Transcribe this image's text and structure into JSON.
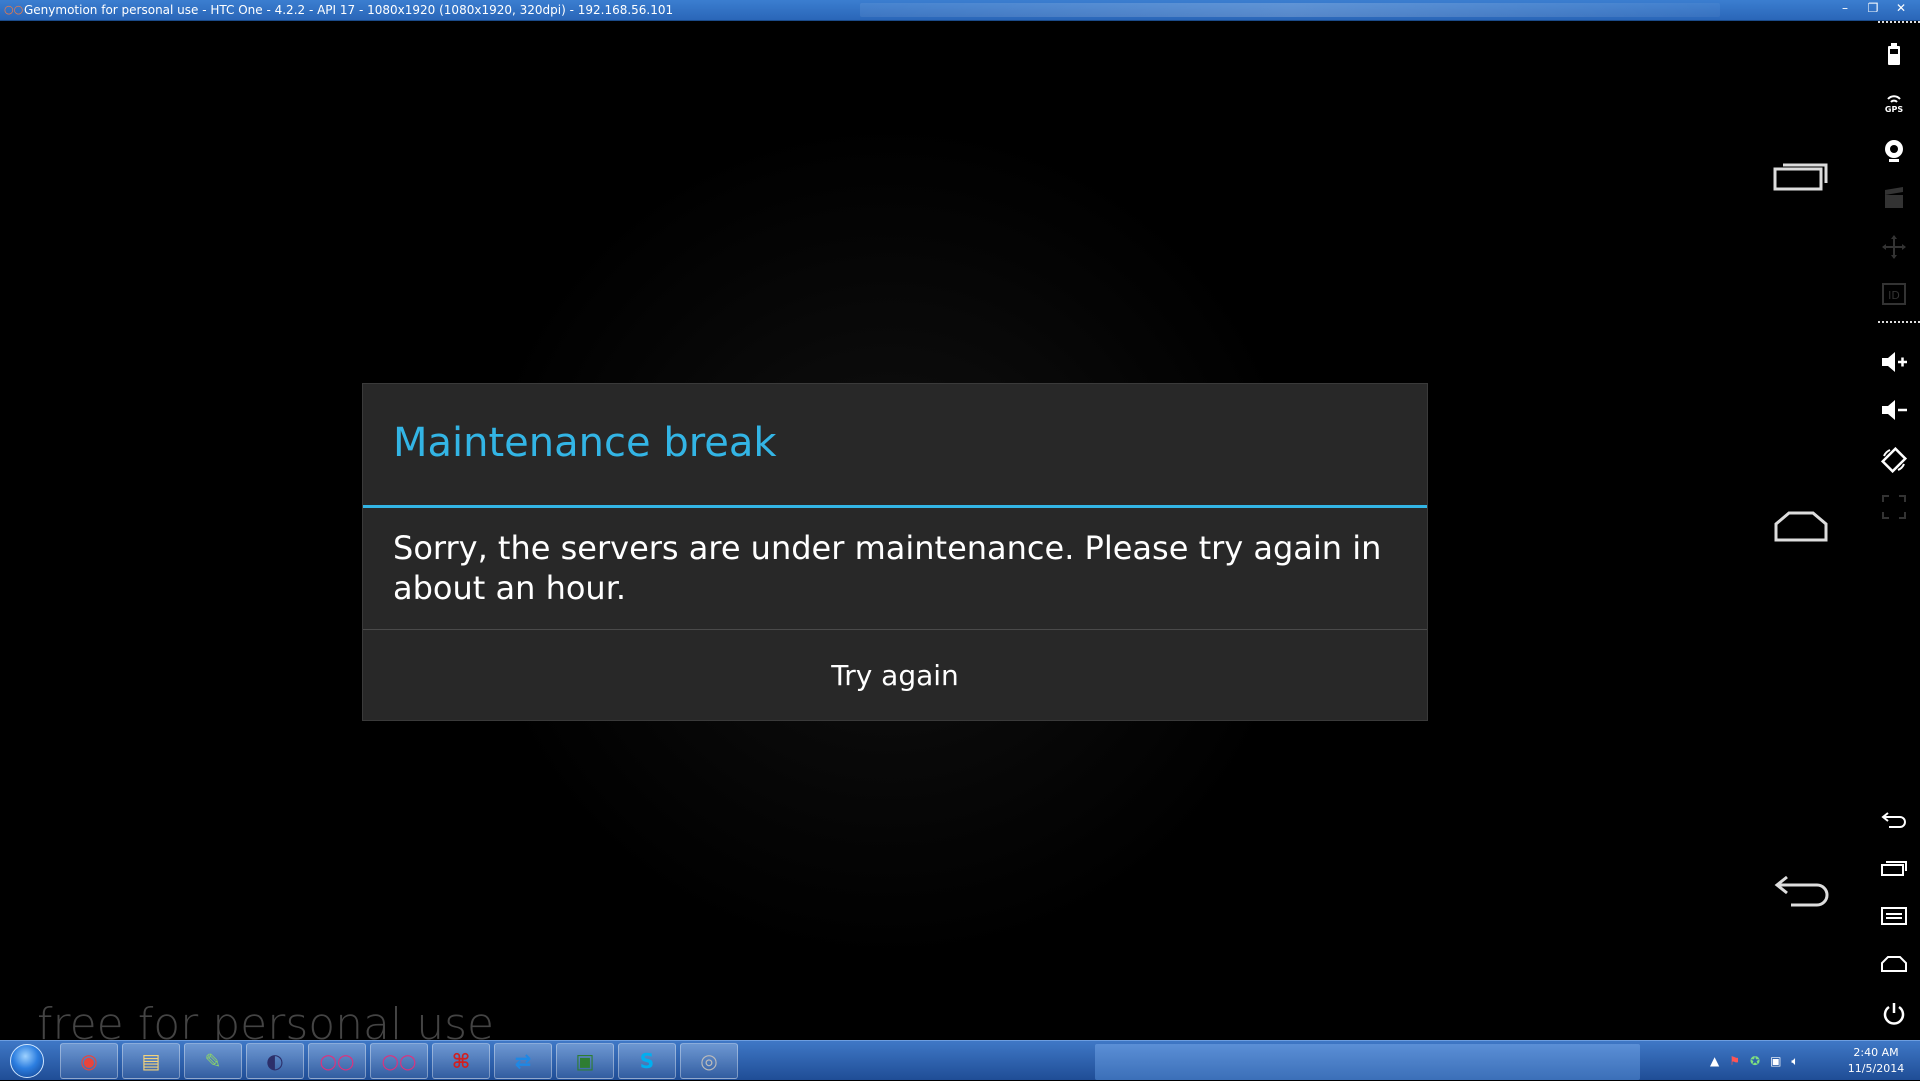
{
  "window": {
    "title": "Genymotion for personal use - HTC One - 4.2.2 - API 17 - 1080x1920 (1080x1920, 320dpi) - 192.168.56.101",
    "minimize": "–",
    "restore": "❐",
    "close": "✕"
  },
  "dialog": {
    "title": "Maintenance break",
    "message": "Sorry, the servers are under maintenance. Please try again in about an hour.",
    "button": "Try again",
    "accent_color": "#33b5e5"
  },
  "watermark": "free for personal use",
  "panel": {
    "gps_label": "GPS",
    "id_label": "ID"
  },
  "taskbar": {
    "items": [
      {
        "name": "chrome-icon",
        "glyph": "◉",
        "color": "#e8453c"
      },
      {
        "name": "file-explorer-icon",
        "glyph": "▤",
        "color": "#f3d27a"
      },
      {
        "name": "notepad-plus-icon",
        "glyph": "✎",
        "color": "#8bd36a"
      },
      {
        "name": "eclipse-icon",
        "glyph": "◐",
        "color": "#2c2f6a"
      },
      {
        "name": "genymotion-icon",
        "glyph": "○○",
        "color": "#e0307c"
      },
      {
        "name": "genymotion-shell-icon",
        "glyph": "○○",
        "color": "#e0307c"
      },
      {
        "name": "adobe-reader-icon",
        "glyph": "⌘",
        "color": "#d11f1f"
      },
      {
        "name": "teamviewer-icon",
        "glyph": "⇄",
        "color": "#1e88e5"
      },
      {
        "name": "monitor-icon",
        "glyph": "▣",
        "color": "#2e7d32"
      },
      {
        "name": "skype-icon",
        "glyph": "S",
        "color": "#00aff0"
      },
      {
        "name": "media-icon",
        "glyph": "◎",
        "color": "#bbbbbb"
      }
    ],
    "clock_time": "2:40 AM",
    "clock_date": "11/5/2014"
  }
}
